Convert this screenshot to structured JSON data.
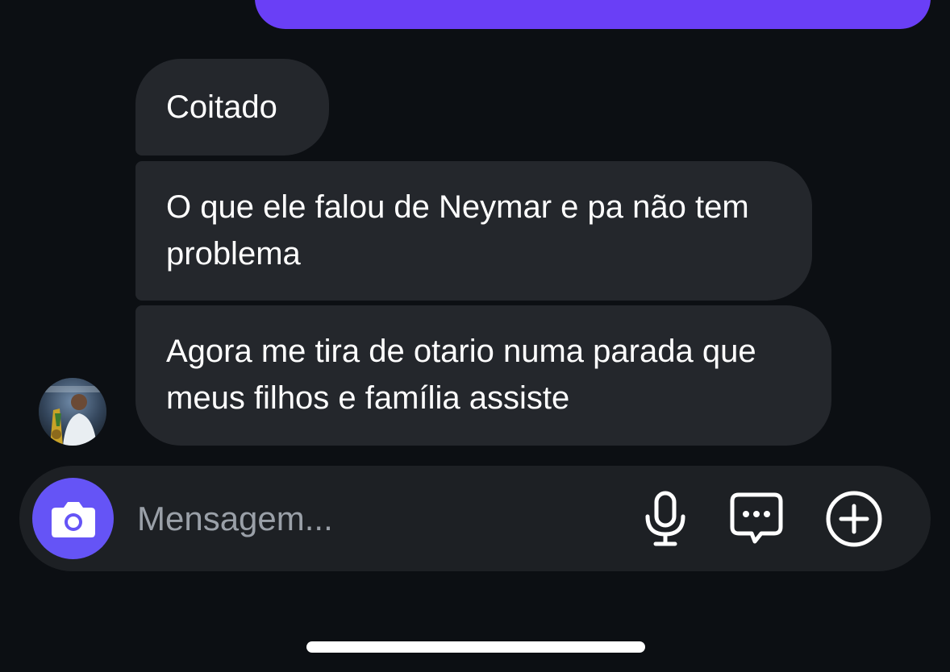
{
  "colors": {
    "background": "#0c0f13",
    "sent_bubble": "#6a3ff6",
    "received_bubble": "#24272c",
    "composer": "#1d2024",
    "camera_button": "#6554f6",
    "placeholder": "#9aa0a8"
  },
  "thread": {
    "messages": [
      {
        "sender": "other",
        "text": "Coitado"
      },
      {
        "sender": "other",
        "text": "O que ele falou de Neymar e pa não tem problema"
      },
      {
        "sender": "other",
        "text": "Agora me tira de otario numa parada que meus filhos e família assiste"
      }
    ],
    "avatar_icon": "user-avatar"
  },
  "composer": {
    "placeholder": "Mensagem...",
    "camera_icon": "camera-icon",
    "mic_icon": "microphone-icon",
    "sticker_icon": "chat-bubble-icon",
    "plus_icon": "plus-circle-icon"
  }
}
